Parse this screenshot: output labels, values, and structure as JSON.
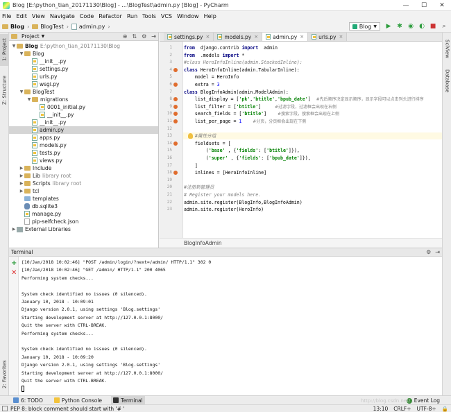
{
  "window": {
    "title": "Blog [E:\\python_tian_20171130\\Blog] - ...\\BlogTest\\admin.py [Blog] - PyCharm",
    "controls": [
      "—",
      "☐",
      "✕"
    ]
  },
  "menu": [
    "File",
    "Edit",
    "View",
    "Navigate",
    "Code",
    "Refactor",
    "Run",
    "Tools",
    "VCS",
    "Window",
    "Help"
  ],
  "breadcrumb": [
    "Blog",
    "BlogTest",
    "admin.py"
  ],
  "run_config": "Blog",
  "project_panel": {
    "title": "Project",
    "items": [
      {
        "label": "Blog",
        "extra": "E:\\python_tian_20171130\\Blog",
        "type": "folder",
        "level": 0,
        "expanded": true,
        "bold": true
      },
      {
        "label": "Blog",
        "type": "folder",
        "level": 1,
        "expanded": true
      },
      {
        "label": "__init__.py",
        "type": "py",
        "level": 2
      },
      {
        "label": "settings.py",
        "type": "py",
        "level": 2
      },
      {
        "label": "urls.py",
        "type": "py",
        "level": 2
      },
      {
        "label": "wsgi.py",
        "type": "py",
        "level": 2
      },
      {
        "label": "BlogTest",
        "type": "folder",
        "level": 1,
        "expanded": true
      },
      {
        "label": "migrations",
        "type": "folder",
        "level": 2,
        "expanded": true
      },
      {
        "label": "0001_initial.py",
        "type": "py",
        "level": 3
      },
      {
        "label": "__init__.py",
        "type": "py",
        "level": 3
      },
      {
        "label": "__init__.py",
        "type": "py",
        "level": 2
      },
      {
        "label": "admin.py",
        "type": "py",
        "level": 2,
        "selected": true
      },
      {
        "label": "apps.py",
        "type": "py",
        "level": 2
      },
      {
        "label": "models.py",
        "type": "py",
        "level": 2
      },
      {
        "label": "tests.py",
        "type": "py",
        "level": 2
      },
      {
        "label": "views.py",
        "type": "py",
        "level": 2
      },
      {
        "label": "Include",
        "type": "folder",
        "level": 1,
        "collapsed": true
      },
      {
        "label": "Lib",
        "extra": "library root",
        "type": "folder",
        "level": 1,
        "collapsed": true
      },
      {
        "label": "Scripts",
        "extra": "library root",
        "type": "folder",
        "level": 1,
        "collapsed": true
      },
      {
        "label": "tcl",
        "type": "folder",
        "level": 1,
        "collapsed": true
      },
      {
        "label": "templates",
        "type": "folder-blue",
        "level": 1
      },
      {
        "label": "db.sqlite3",
        "type": "db",
        "level": 1
      },
      {
        "label": "manage.py",
        "type": "py",
        "level": 1
      },
      {
        "label": "pip-selfcheck.json",
        "type": "json",
        "level": 1
      },
      {
        "label": "External Libraries",
        "type": "lib",
        "level": 0,
        "collapsed": true
      }
    ]
  },
  "editor_tabs": [
    {
      "label": "settings.py",
      "active": false
    },
    {
      "label": "models.py",
      "active": false
    },
    {
      "label": "admin.py",
      "active": true
    },
    {
      "label": "urls.py",
      "active": false
    }
  ],
  "code_lines": [
    {
      "n": "1",
      "segs": [
        [
          "kw",
          "from"
        ],
        [
          "",
          "  django.contrib "
        ],
        [
          "kw",
          "import"
        ],
        [
          "",
          "  admin"
        ]
      ]
    },
    {
      "n": "2",
      "segs": [
        [
          "kw",
          "from"
        ],
        [
          "",
          "  .models "
        ],
        [
          "kw",
          "import"
        ],
        [
          "",
          " *"
        ]
      ]
    },
    {
      "n": "3",
      "segs": [
        [
          "cmt",
          "#class HeroInfoInline(admin.StackedInline):"
        ]
      ]
    },
    {
      "n": "4",
      "segs": [
        [
          "kw",
          "class"
        ],
        [
          "",
          " HeroInfoInline(admin.TabularInline):"
        ]
      ],
      "mark": true
    },
    {
      "n": "5",
      "segs": [
        [
          "",
          "    model = HeroInfo"
        ]
      ]
    },
    {
      "n": "6",
      "segs": [
        [
          "",
          "    extra = "
        ],
        [
          "num",
          "3"
        ]
      ],
      "mark": true
    },
    {
      "n": "7",
      "segs": [
        [
          "kw",
          "class"
        ],
        [
          "",
          " BlogInfoAdmin(admin.ModelAdmin):"
        ]
      ]
    },
    {
      "n": "8",
      "segs": [
        [
          "",
          "    list_display = ["
        ],
        [
          "str",
          "'pk'"
        ],
        [
          ",",
          ","
        ],
        [
          "str",
          "'btitle'"
        ],
        [
          ",",
          ","
        ],
        [
          "str",
          "'bpub_date'"
        ],
        [
          "",
          "]  "
        ],
        [
          "zh",
          "#先后顺序决定显示顺序，显示字段可以点击列头进行排序"
        ]
      ],
      "mark": true
    },
    {
      "n": "9",
      "segs": [
        [
          "",
          "    list_filter = ["
        ],
        [
          "str",
          "'btitle'"
        ],
        [
          "",
          "]     "
        ],
        [
          "zh",
          "#过滤字段，过滤框会出现在右侧"
        ]
      ],
      "mark": true
    },
    {
      "n": "10",
      "segs": [
        [
          "",
          "    search_fields = ["
        ],
        [
          "str",
          "'btitle'"
        ],
        [
          "",
          "]    "
        ],
        [
          "zh",
          "#搜索字段，搜索框会出现在上侧"
        ]
      ],
      "mark": true
    },
    {
      "n": "11",
      "segs": [
        [
          "",
          "    list_per_page = "
        ],
        [
          "num",
          "1"
        ],
        [
          "",
          "    "
        ],
        [
          "zh",
          "#分页，分页框会出现在下侧"
        ]
      ],
      "mark": true
    },
    {
      "n": "12",
      "segs": [
        [
          "",
          ""
        ]
      ]
    },
    {
      "n": "13",
      "segs": [
        [
          "",
          "    "
        ],
        [
          "cmt",
          "#属性分组"
        ]
      ],
      "highlight": true,
      "bulb": true
    },
    {
      "n": "14",
      "segs": [
        [
          "",
          "    fieldsets = ["
        ]
      ],
      "mark": true
    },
    {
      "n": "15",
      "segs": [
        [
          "",
          "        ("
        ],
        [
          "str",
          "'base'"
        ],
        [
          "",
          " , {"
        ],
        [
          "str",
          "'fields'"
        ],
        [
          "",
          ": ["
        ],
        [
          "str",
          "'btitle'"
        ],
        [
          "",
          "]}),"
        ]
      ]
    },
    {
      "n": "16",
      "segs": [
        [
          "",
          "        ("
        ],
        [
          "str",
          "'super'"
        ],
        [
          "",
          " , {"
        ],
        [
          "str",
          "'fields'"
        ],
        [
          "",
          ": ["
        ],
        [
          "str",
          "'bpub_date'"
        ],
        [
          "",
          "]}),"
        ]
      ]
    },
    {
      "n": "17",
      "segs": [
        [
          "",
          "    ]"
        ]
      ]
    },
    {
      "n": "18",
      "segs": [
        [
          "",
          "    inlines = [HeroInfoInline]"
        ]
      ],
      "mark": true
    },
    {
      "n": "19",
      "segs": [
        [
          "",
          ""
        ]
      ]
    },
    {
      "n": "20",
      "segs": [
        [
          "cmt",
          "#注册到管理员"
        ]
      ]
    },
    {
      "n": "21",
      "segs": [
        [
          "cmt",
          "# Register your models here."
        ]
      ]
    },
    {
      "n": "22",
      "segs": [
        [
          "",
          "admin.site.register(BlogInfo,BlogInfoAdmin)"
        ]
      ]
    },
    {
      "n": "23",
      "segs": [
        [
          "",
          "admin.site.register(HeroInfo)"
        ]
      ]
    }
  ],
  "editor_footer": "BlogInfoAdmin",
  "terminal": {
    "title": "Terminal",
    "lines": [
      "[10/Jan/2018 10:02:46] \"POST /admin/login/?next=/admin/ HTTP/1.1\" 302 0",
      "[10/Jan/2018 10:02:46] \"GET /admin/ HTTP/1.1\" 200 4065",
      "Performing system checks...",
      "",
      "System check identified no issues (0 silenced).",
      "January 10, 2018 - 10:09:01",
      "Django version 2.0.1, using settings 'Blog.settings'",
      "Starting development server at http://127.0.0.1:8000/",
      "Quit the server with CTRL-BREAK.",
      "Performing system checks...",
      "",
      "System check identified no issues (0 silenced).",
      "January 10, 2018 - 10:09:20",
      "Django version 2.0.1, using settings 'Blog.settings'",
      "Starting development server at http://127.0.0.1:8000/",
      "Quit the server with CTRL-BREAK."
    ]
  },
  "tool_tabs": {
    "todo": "6: TODO",
    "python_console": "Python Console",
    "terminal": "Terminal",
    "event_log": "Event Log"
  },
  "side_tabs": {
    "project": "1: Project",
    "structure": "Z: Structure",
    "favorites": "2: Favorites",
    "sciview": "SciView",
    "database": "Database"
  },
  "status": {
    "message": "PEP 8: block comment should start with '# '",
    "position": "13:10",
    "line_sep": "CRLF÷",
    "encoding": "UTF-8÷"
  },
  "watermark": "http://blog.csdn.net/..."
}
